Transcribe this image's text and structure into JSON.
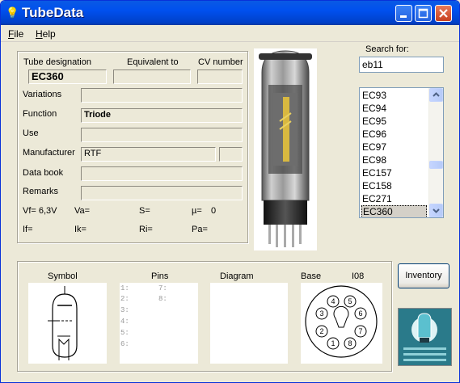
{
  "window": {
    "title": "TubeData"
  },
  "menu": {
    "file_first": "F",
    "file_rest": "ile",
    "help_first": "H",
    "help_rest": "elp"
  },
  "header": {
    "tube_designation_label": "Tube designation",
    "equivalent_label": "Equivalent to",
    "cv_label": "CV number",
    "tube_designation_value": "EC360",
    "equivalent_value": "",
    "cv_value": ""
  },
  "fields": {
    "variations_label": "Variations",
    "function_label": "Function",
    "function_value": "Triode",
    "use_label": "Use",
    "manufacturer_label": "Manufacturer",
    "manufacturer_value": "RTF",
    "databook_label": "Data book",
    "remarks_label": "Remarks"
  },
  "params": {
    "vf": "Vf= 6,3V",
    "va": "Va=",
    "s": "S=",
    "mu": "µ=",
    "mu_value": "0",
    "if": "If=",
    "ik": "Ik=",
    "ri": "Ri=",
    "pa": "Pa="
  },
  "search": {
    "label": "Search for:",
    "value": "eb11"
  },
  "list": {
    "items": [
      "EC93",
      "EC94",
      "EC95",
      "EC96",
      "EC97",
      "EC98",
      "EC157",
      "EC158",
      "EC271",
      "EC360"
    ],
    "selected": "EC360"
  },
  "bottom": {
    "symbol_label": "Symbol",
    "pins_label": "Pins",
    "diagram_label": "Diagram",
    "base_label": "Base",
    "base_type": "I08",
    "pins": [
      "1:",
      "2:",
      "3:",
      "4:",
      "5:",
      "6:",
      "7:",
      "8:"
    ],
    "base_pin_numbers": [
      "1",
      "2",
      "3",
      "4",
      "5",
      "6",
      "7",
      "8"
    ]
  },
  "buttons": {
    "inventory": "Inventory"
  },
  "colors": {
    "title_blue": "#0050ee",
    "close_red": "#c8401f",
    "panel_bg": "#ece9d8"
  },
  "icons": [
    "app-bulb-icon",
    "minimize-icon",
    "maximize-icon",
    "close-icon",
    "scroll-up-icon",
    "scroll-down-icon"
  ]
}
